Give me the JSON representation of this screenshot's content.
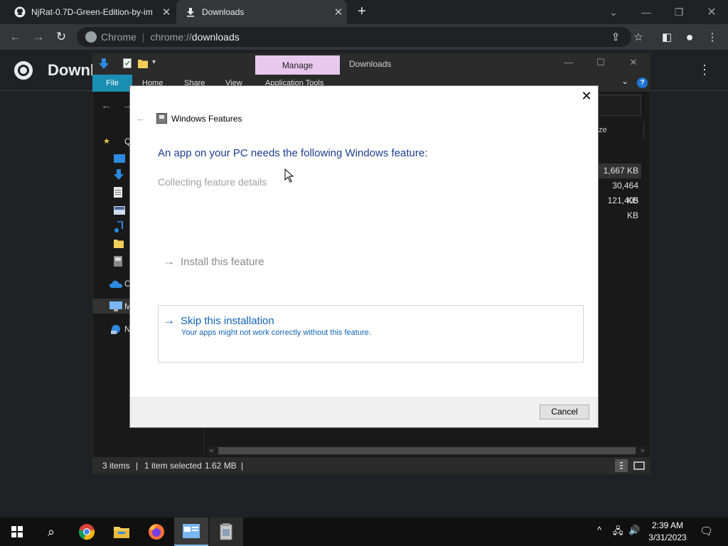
{
  "browser": {
    "tabs": [
      {
        "label": "NjRat-0.7D-Green-Edition-by-im",
        "close": "✕"
      },
      {
        "label": "Downloads",
        "close": "✕"
      }
    ],
    "new_tab": "+",
    "window_controls": {
      "minimize": "—",
      "restore": "❐",
      "close": "✕",
      "tab_search": "⌄"
    },
    "omnibox": {
      "site": "Chrome",
      "separator": "|",
      "scheme": "chrome://",
      "path": "downloads"
    },
    "nav": {
      "back": "←",
      "forward": "→",
      "reload": "↻"
    },
    "toolbar_icons": {
      "share": "⇪",
      "bookmark": "☆",
      "side_panel": "◧",
      "profile": "●",
      "menu": "⋮"
    }
  },
  "downloads_page": {
    "title": "Downl",
    "menu": "⋮"
  },
  "explorer": {
    "manage_tab": "Manage",
    "title": "Downloads",
    "window_controls": {
      "minimize": "—",
      "maximize": "☐",
      "close": "✕"
    },
    "ribbon_tabs": [
      "File",
      "Home",
      "Share",
      "View",
      "Application Tools"
    ],
    "collapse": "⌄",
    "help": "?",
    "nav": {
      "back": "←",
      "forward": "→"
    },
    "column_header": "ze",
    "sizes": [
      "1,667 KB",
      "30,464 KB",
      "121,405 KB"
    ],
    "nav_pane_labels": [
      "Q",
      "O",
      "M",
      "N"
    ],
    "status": {
      "items": "3 items",
      "selected": "1 item selected",
      "size": "1.62 MB",
      "sep": "|"
    },
    "scroll": {
      "left": "<",
      "right": ">"
    }
  },
  "dialog": {
    "title": "Windows Features",
    "close": "✕",
    "back": "←",
    "heading": "An app on your PC needs the following Windows feature:",
    "status": "Collecting feature details",
    "install": {
      "arrow": "→",
      "label": "Install this feature"
    },
    "skip": {
      "arrow": "→",
      "label": "Skip this installation",
      "description": "Your apps might not work correctly without this feature."
    },
    "cancel": "Cancel"
  },
  "taskbar": {
    "search": "⌕",
    "tray": {
      "chevron": "^",
      "network": "🖧",
      "volume": "🔊"
    },
    "clock": {
      "time": "2:39 AM",
      "date": "3/31/2023"
    },
    "notifications": "🗨"
  },
  "colors": {
    "dialog_heading": "#1c3d8f",
    "skip_link": "#1063b5",
    "manage_tab": "#e8c8ee",
    "file_tab": "#1b8fb3"
  }
}
